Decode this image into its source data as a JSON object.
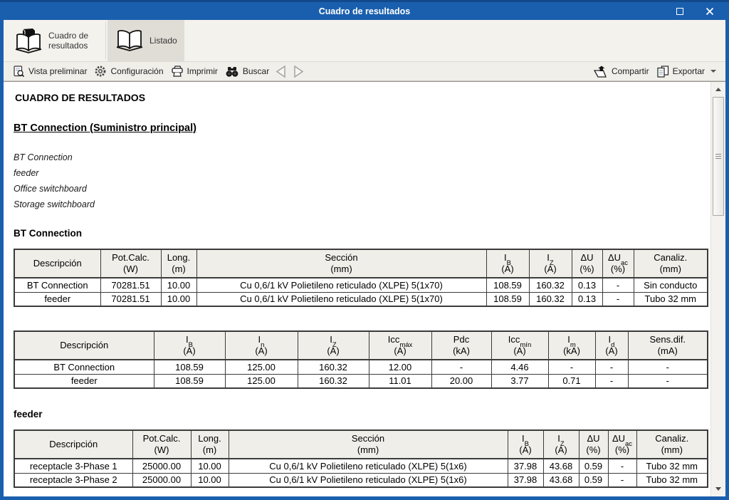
{
  "window": {
    "title": "Cuadro de resultados"
  },
  "ribbon": {
    "tabs": [
      {
        "label": "Cuadro de resultados"
      },
      {
        "label": "Listado"
      }
    ]
  },
  "toolbar": {
    "preview_label": "Vista preliminar",
    "settings_label": "Configuración",
    "print_label": "Imprimir",
    "search_label": "Buscar",
    "share_label": "Compartir",
    "export_label": "Exportar"
  },
  "document": {
    "title": "CUADRO DE RESULTADOS",
    "subtitle": "BT Connection (Suministro principal)",
    "tree": [
      "BT Connection",
      "feeder",
      "Office switchboard",
      "Storage switchboard"
    ],
    "section1_heading": "BT Connection",
    "section2_heading": "feeder",
    "table1": {
      "widths": [
        121,
        85,
        50,
        407,
        60,
        60,
        43,
        44,
        104
      ],
      "headers": [
        {
          "t": "Descripción"
        },
        {
          "t": "Pot.Calc.",
          "u": "(W)"
        },
        {
          "t": "Long.",
          "u": "(m)"
        },
        {
          "t": "Sección",
          "u": "(mm)"
        },
        {
          "t": "I",
          "s": "B",
          "u": "(A)"
        },
        {
          "t": "I",
          "s": "Z",
          "u": "(A)"
        },
        {
          "t": "ΔU",
          "u": "(%)"
        },
        {
          "t": "ΔU",
          "s": "ac",
          "u": "(%)"
        },
        {
          "t": "Canaliz.",
          "u": "(mm)"
        }
      ],
      "rows": [
        [
          "BT Connection",
          "70281.51",
          "10.00",
          "Cu 0,6/1 kV Polietileno reticulado (XLPE) 5(1x70)",
          "108.59",
          "160.32",
          "0.13",
          "-",
          "Sin conducto"
        ],
        [
          "feeder",
          "70281.51",
          "10.00",
          "Cu 0,6/1 kV Polietileno reticulado (XLPE) 5(1x70)",
          "108.59",
          "160.32",
          "0.13",
          "-",
          "Tubo 32 mm"
        ]
      ]
    },
    "table2": {
      "widths": [
        196,
        100,
        102,
        100,
        88,
        84,
        80,
        66,
        46,
        112
      ],
      "headers": [
        {
          "t": "Descripción"
        },
        {
          "t": "I",
          "s": "B",
          "u": "(A)"
        },
        {
          "t": "I",
          "s": "n",
          "u": "(A)"
        },
        {
          "t": "I",
          "s": "Z",
          "u": "(A)"
        },
        {
          "t": "Icc",
          "s": "máx",
          "u": "(A)"
        },
        {
          "t": "Pdc",
          "u": "(kA)"
        },
        {
          "t": "Icc",
          "s": "mín",
          "u": "(A)"
        },
        {
          "t": "I",
          "s": "m",
          "u": "(kA)"
        },
        {
          "t": "I",
          "s": "d",
          "u": "(A)"
        },
        {
          "t": "Sens.dif.",
          "u": "(mA)"
        }
      ],
      "rows": [
        [
          "BT Connection",
          "108.59",
          "125.00",
          "160.32",
          "12.00",
          "-",
          "4.46",
          "-",
          "-",
          "-"
        ],
        [
          "feeder",
          "108.59",
          "125.00",
          "160.32",
          "11.01",
          "20.00",
          "3.77",
          "0.71",
          "-",
          "-"
        ]
      ]
    },
    "table3": {
      "widths": [
        166,
        82,
        53,
        392,
        50,
        50,
        41,
        40,
        100
      ],
      "headers": [
        {
          "t": "Descripción"
        },
        {
          "t": "Pot.Calc.",
          "u": "(W)"
        },
        {
          "t": "Long.",
          "u": "(m)"
        },
        {
          "t": "Sección",
          "u": "(mm)"
        },
        {
          "t": "I",
          "s": "B",
          "u": "(A)"
        },
        {
          "t": "I",
          "s": "Z",
          "u": "(A)"
        },
        {
          "t": "ΔU",
          "u": "(%)"
        },
        {
          "t": "ΔU",
          "s": "ac",
          "u": "(%)"
        },
        {
          "t": "Canaliz.",
          "u": "(mm)"
        }
      ],
      "rows": [
        [
          "receptacle 3-Phase 1",
          "25000.00",
          "10.00",
          "Cu 0,6/1 kV Polietileno reticulado (XLPE) 5(1x6)",
          "37.98",
          "43.68",
          "0.59",
          "-",
          "Tubo 32 mm"
        ],
        [
          "receptacle 3-Phase 2",
          "25000.00",
          "10.00",
          "Cu 0,6/1 kV Polietileno reticulado (XLPE) 5(1x6)",
          "37.98",
          "43.68",
          "0.59",
          "-",
          "Tubo 32 mm"
        ]
      ]
    }
  },
  "colors": {
    "titlebar_blue": "#1A5FAE",
    "titlebar_top": "#11498C",
    "ribbon_bg": "#F4F2ED",
    "selected_tab_bg": "#E0DDD6",
    "table_header_bg": "#F0EEE9",
    "table_border": "#3B3B3B"
  }
}
